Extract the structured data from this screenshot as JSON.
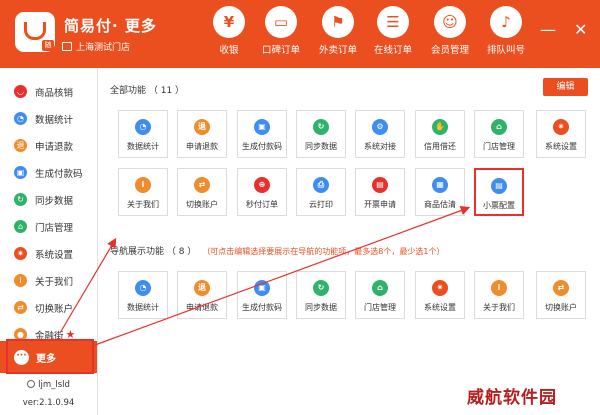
{
  "header": {
    "app_title": "简易付· 更多",
    "store_name": "上海测试门店",
    "logo_badge": "随",
    "nav": [
      {
        "label": "收银",
        "glyph": "¥",
        "icon": "yen-icon"
      },
      {
        "label": "口碑订单",
        "glyph": "▭",
        "icon": "wallet-icon"
      },
      {
        "label": "外卖订单",
        "glyph": "⚑",
        "icon": "takeout-icon"
      },
      {
        "label": "在线订单",
        "glyph": "☰",
        "icon": "online-order-icon"
      },
      {
        "label": "会员管理",
        "glyph": "☺",
        "icon": "member-icon"
      },
      {
        "label": "排队叫号",
        "glyph": "♪",
        "icon": "bell-icon"
      }
    ],
    "minimize": "—",
    "close": "✕"
  },
  "sidebar": {
    "items": [
      {
        "label": "商品核销",
        "color": "#e8302c",
        "glyph": "◡"
      },
      {
        "label": "数据统计",
        "color": "#3d8ef0",
        "glyph": "◔"
      },
      {
        "label": "申请退款",
        "color": "#f08c2c",
        "glyph": "退"
      },
      {
        "label": "生成付款码",
        "color": "#3d8ef0",
        "glyph": "▣"
      },
      {
        "label": "同步数据",
        "color": "#2fb36b",
        "glyph": "↻"
      },
      {
        "label": "门店管理",
        "color": "#2fb36b",
        "glyph": "⌂"
      },
      {
        "label": "系统设置",
        "color": "#ec4f1f",
        "glyph": "✷"
      },
      {
        "label": "关于我们",
        "color": "#f08c2c",
        "glyph": "i"
      },
      {
        "label": "切换账户",
        "color": "#f08c2c",
        "glyph": "⇄"
      },
      {
        "label": "金融街",
        "color": "#f08c2c",
        "glyph": "●"
      }
    ],
    "more_label": "更多",
    "more_glyph": "···",
    "username": "ljm_lsld",
    "version": "ver:2.1.0.94"
  },
  "main": {
    "all_title": "全部功能 （ 11 ）",
    "edit_label": "编辑",
    "all_tiles": [
      {
        "label": "数据统计",
        "color": "#3d8ef0",
        "glyph": "◔"
      },
      {
        "label": "申请退款",
        "color": "#f08c2c",
        "glyph": "退"
      },
      {
        "label": "生成付款码",
        "color": "#3d8ef0",
        "glyph": "▣"
      },
      {
        "label": "同步数据",
        "color": "#2fb36b",
        "glyph": "↻"
      },
      {
        "label": "系统对接",
        "color": "#3d8ef0",
        "glyph": "⚙"
      },
      {
        "label": "信用借还",
        "color": "#2fb36b",
        "glyph": "✋"
      },
      {
        "label": "门店管理",
        "color": "#2fb36b",
        "glyph": "⌂"
      },
      {
        "label": "系统设置",
        "color": "#ec4f1f",
        "glyph": "✷"
      },
      {
        "label": "关于我们",
        "color": "#f08c2c",
        "glyph": "i"
      },
      {
        "label": "切换账户",
        "color": "#f08c2c",
        "glyph": "⇄"
      },
      {
        "label": "秒付订单",
        "color": "#e8302c",
        "glyph": "⊕"
      },
      {
        "label": "云打印",
        "color": "#3d8ef0",
        "glyph": "⎙"
      },
      {
        "label": "开票申请",
        "color": "#e8302c",
        "glyph": "▤"
      },
      {
        "label": "商品估清",
        "color": "#3d8ef0",
        "glyph": "▦"
      },
      {
        "label": "小票配置",
        "color": "#3d8ef0",
        "glyph": "▤"
      }
    ],
    "nav_title": "导航展示功能 （ 8 ）",
    "nav_note": "（可点击编辑选择要展示在导航的功能项，最多选8个，最少选1个）",
    "nav_tiles": [
      {
        "label": "数据统计",
        "color": "#3d8ef0",
        "glyph": "◔"
      },
      {
        "label": "申请退款",
        "color": "#f08c2c",
        "glyph": "退"
      },
      {
        "label": "生成付款码",
        "color": "#3d8ef0",
        "glyph": "▣"
      },
      {
        "label": "同步数据",
        "color": "#2fb36b",
        "glyph": "↻"
      },
      {
        "label": "门店管理",
        "color": "#2fb36b",
        "glyph": "⌂"
      },
      {
        "label": "系统设置",
        "color": "#ec4f1f",
        "glyph": "✷"
      },
      {
        "label": "关于我们",
        "color": "#f08c2c",
        "glyph": "i"
      },
      {
        "label": "切换账户",
        "color": "#f08c2c",
        "glyph": "⇄"
      }
    ]
  },
  "watermark": "威航软件园",
  "colors": {
    "accent": "#ec4f1f",
    "highlight": "#e8302c"
  }
}
